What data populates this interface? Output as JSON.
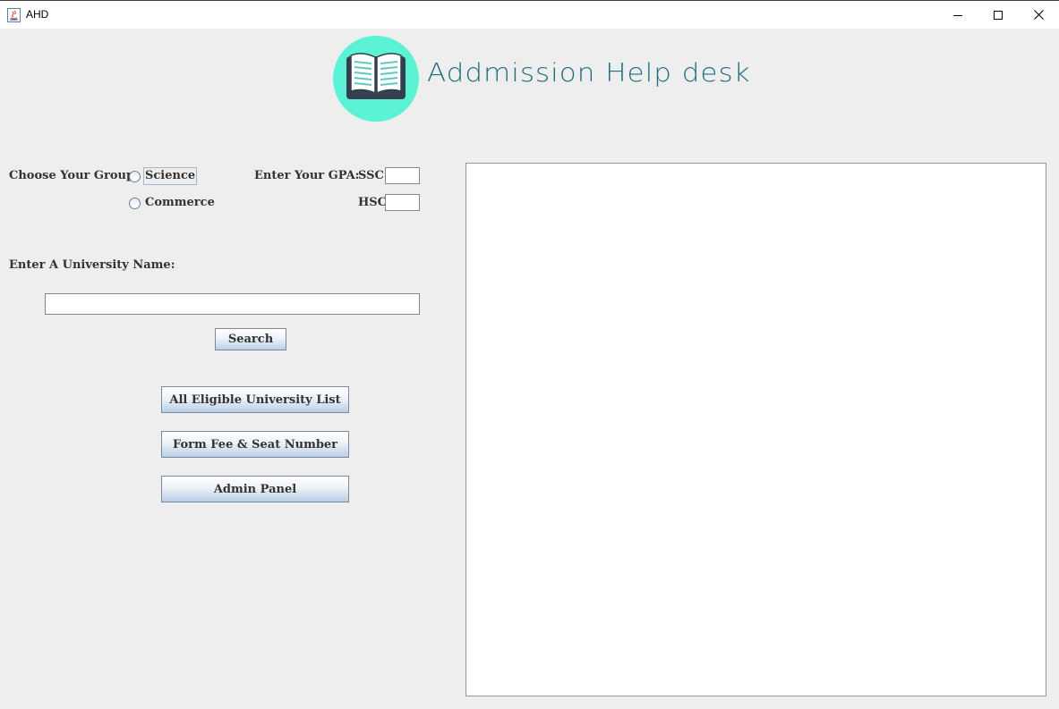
{
  "window": {
    "title": "AHD"
  },
  "header": {
    "logo_text": "Addmission Help desk"
  },
  "form": {
    "group_label": "Choose Your Group:",
    "group_options": [
      "Science",
      "Commerce"
    ],
    "gpa_label": "Enter Your GPA:",
    "ssc_label": "SSC",
    "ssc_value": "",
    "hsc_label": "HSC",
    "hsc_value": "",
    "university_label": "Enter A University Name:",
    "university_value": "",
    "search_label": "Search"
  },
  "actions": {
    "eligible_list": "All Eligible University List",
    "form_fee": "Form Fee & Seat Number",
    "admin_panel": "Admin Panel"
  },
  "colors": {
    "logo_circle": "#5cf2d6",
    "logo_text": "#1e6f7f",
    "background": "#eeeeee"
  }
}
